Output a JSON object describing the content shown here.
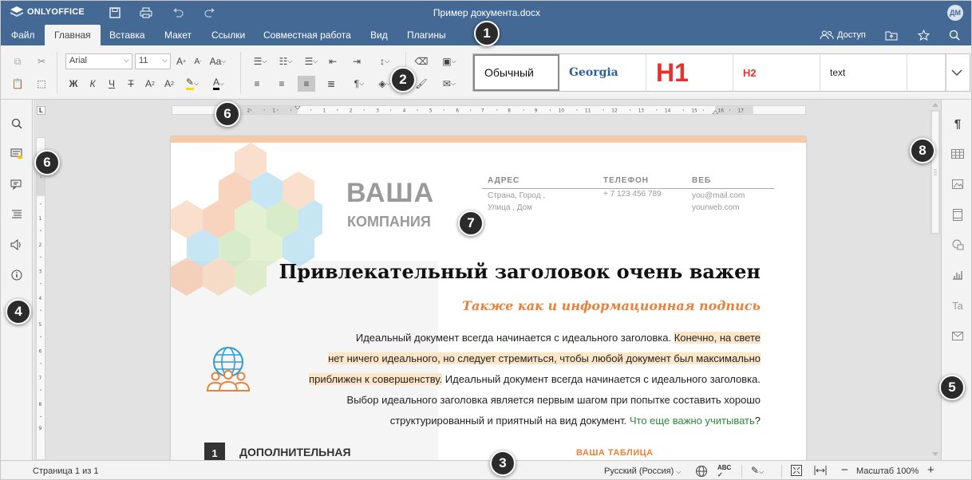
{
  "app": {
    "logo": "ONLYOFFICE",
    "doc_title": "Пример документа.docx",
    "avatar": "ДМ"
  },
  "menu": {
    "tabs": [
      "Файл",
      "Главная",
      "Вставка",
      "Макет",
      "Ссылки",
      "Совместная работа",
      "Вид",
      "Плагины"
    ],
    "active": "Главная",
    "share": "Доступ"
  },
  "toolbar": {
    "font": "Arial",
    "size": "11",
    "case": "Aa"
  },
  "styles": [
    "Обычный",
    "Georgia",
    "H1",
    "H2",
    "text"
  ],
  "doc": {
    "company_1": "ВАША",
    "company_2": "КОМПАНИЯ",
    "contact_heads": [
      "АДРЕС",
      "ТЕЛЕФОН",
      "ВЕБ"
    ],
    "address": [
      "Страна,  Город ,",
      "Улица , Дом"
    ],
    "phone": "+ 7 123 456 789",
    "web": [
      "you@mail.com",
      "yourweb.com"
    ],
    "heading": "Привлекательный заголовок очень важен",
    "subtitle": "Также как и информационная подпись",
    "para_lines": [
      {
        "a": "Идеальный документ всегда начинается с идеального заголовка. ",
        "b": "Конечно, на свете",
        "c": ""
      },
      {
        "a": "",
        "b": "нет ничего идеального, но следует стремиться, чтобы любой документ был максимально",
        "c": ""
      },
      {
        "a": "",
        "b": "приближен к совершенству.",
        "c": " Идеальный документ всегда начинается с идеального заголовка."
      },
      {
        "a": "Выбор идеального заголовка является первым шагом при попытке составить хорошо",
        "b": "",
        "c": ""
      },
      {
        "a": "структурированный и приятный на вид документ. ",
        "b": "",
        "c": ""
      }
    ],
    "para_link": "Что еще важно учитывать",
    "para_end": "?",
    "section_num": "1",
    "section_title": "ДОПОЛНИТЕЛЬНАЯ",
    "table_title": "ВАША ТАБЛИЦА"
  },
  "status": {
    "page": "Страница 1 из 1",
    "language": "Русский (Россия)",
    "zoom": "Масштаб 100%"
  },
  "callouts": [
    "1",
    "2",
    "3",
    "4",
    "5",
    "6",
    "6",
    "7",
    "8"
  ],
  "colors": {
    "header": "#446995",
    "accent": "#e8823a",
    "link": "#2a8a3a",
    "highlight": "#fde6c8"
  }
}
